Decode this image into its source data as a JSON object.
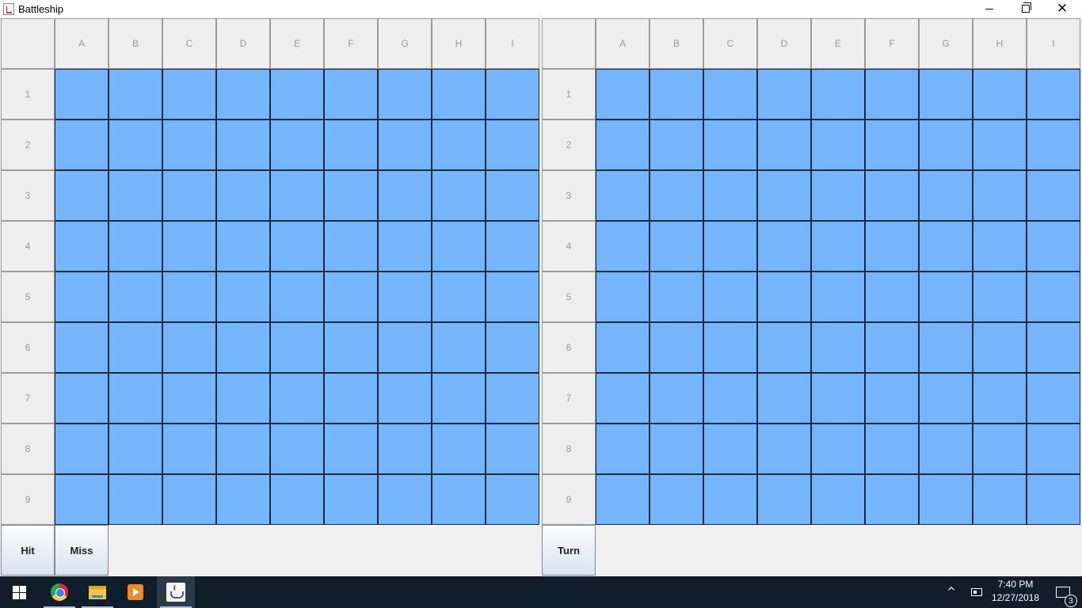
{
  "window": {
    "title": "Battleship",
    "icon": "java-app-icon",
    "controls": [
      "minimize-icon",
      "restore-icon",
      "close-icon"
    ]
  },
  "board_left": {
    "columns": [
      "A",
      "B",
      "C",
      "D",
      "E",
      "F",
      "G",
      "H",
      "I"
    ],
    "rows": [
      "1",
      "2",
      "3",
      "4",
      "5",
      "6",
      "7",
      "8",
      "9"
    ],
    "cell_color": "#75b5fb"
  },
  "board_right": {
    "columns": [
      "A",
      "B",
      "C",
      "D",
      "E",
      "F",
      "G",
      "H",
      "I"
    ],
    "rows": [
      "1",
      "2",
      "3",
      "4",
      "5",
      "6",
      "7",
      "8",
      "9"
    ],
    "cell_color": "#75b5fb"
  },
  "buttons": {
    "hit": "Hit",
    "miss": "Miss",
    "turn": "Turn"
  },
  "taskbar": {
    "apps": [
      "windows-start-icon",
      "chrome-icon",
      "file-explorer-icon",
      "media-player-icon",
      "java-icon"
    ],
    "time": "7:40 PM",
    "date": "12/27/2018",
    "notification_count": "3"
  }
}
